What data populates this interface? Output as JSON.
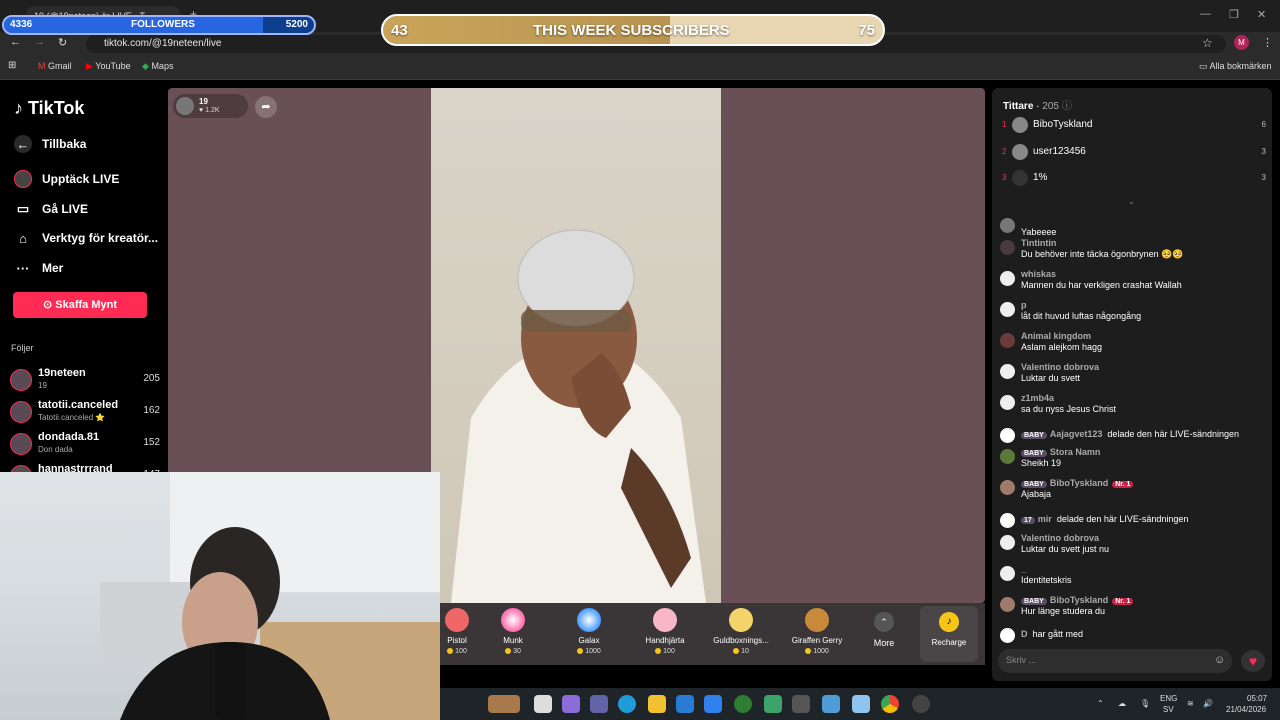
{
  "browser": {
    "tab_title": "19 (@19neteen) är LIVE - T",
    "url": "tiktok.com/@19neteen/live",
    "bookmarks": [
      "Gmail",
      "YouTube",
      "Maps"
    ],
    "all_bookmarks": "Alla bokmärken",
    "profile_initial": "M"
  },
  "overlay": {
    "followers_label": "FOLLOWERS",
    "followers_current": "4336",
    "followers_goal": "5200",
    "followers_progress": 0.834,
    "subs_label": "THIS WEEK SUBSCRIBERS",
    "subs_current": "43",
    "subs_goal": "75",
    "subs_progress": 0.573
  },
  "sidebar": {
    "logo": "TikTok",
    "back": "Tillbaka",
    "items": [
      "Upptäck LIVE",
      "Gå LIVE",
      "Verktyg för kreatör...",
      "Mer"
    ],
    "buy_coins": "Skaffa Mynt",
    "following_header": "Följer",
    "following": [
      {
        "name": "19neteen",
        "sub": "19",
        "count": "205"
      },
      {
        "name": "tatotii.canceled",
        "sub": "Tatotii.canceled ⭐",
        "count": "162"
      },
      {
        "name": "dondada.81",
        "sub": "Don dada",
        "count": "152"
      },
      {
        "name": "hannastrrrand",
        "sub": "",
        "count": "147"
      }
    ]
  },
  "live": {
    "host_name": "19",
    "host_likes": "1.2K"
  },
  "gifts": [
    {
      "name": "Pistol",
      "price": "100"
    },
    {
      "name": "Munk",
      "price": "30"
    },
    {
      "name": "Galax",
      "price": "1000"
    },
    {
      "name": "Handhjärta",
      "price": "100"
    },
    {
      "name": "Guldboxnings...",
      "price": "10"
    },
    {
      "name": "Giraffen Gerry",
      "price": "1000"
    }
  ],
  "gift_more": "More",
  "recharge": "Recharge",
  "viewers": {
    "header": "Tittare",
    "count": "205",
    "list": [
      {
        "rank": "1",
        "name": "BiboTyskland",
        "score": "6"
      },
      {
        "rank": "2",
        "name": "user123456",
        "score": "3"
      },
      {
        "rank": "3",
        "name": "1%",
        "score": "3"
      }
    ]
  },
  "chat": [
    {
      "name": "",
      "text": "Yabeeee"
    },
    {
      "name": "Tintintin",
      "text": "Du behöver inte täcka ögonbrynen 🥺🥺"
    },
    {
      "name": "whiskas",
      "text": "Mannen du har verkligen crashat Wallah"
    },
    {
      "name": "p",
      "text": "låt dit huvud luftas någongång"
    },
    {
      "name": "Animal kingdom",
      "text": "Aslam alejkom hagg"
    },
    {
      "name": "Valentino dobrova",
      "text": "Luktar du svett"
    },
    {
      "name": "z1mb4a",
      "text": "sa du nyss Jesus Christ"
    },
    {
      "name": "Aajagvet123",
      "badge": "BABY",
      "text": "delade den här LIVE-sändningen",
      "inline": true
    },
    {
      "name": "Stora Namn",
      "badge": "BABY",
      "text": "Sheikh 19"
    },
    {
      "name": "BiboTyskland",
      "badge": "BABY",
      "rank_badge": "Nr. 1",
      "text": "Ajabaja"
    },
    {
      "name": "mir",
      "badge": "17",
      "text": "delade den här LIVE-sändningen",
      "inline": true
    },
    {
      "name": "Valentino dobrova",
      "text": "Luktar du svett just nu"
    },
    {
      "name": "_",
      "text": "Identitetskris"
    },
    {
      "name": "BiboTyskland",
      "badge": "BABY",
      "rank_badge": "Nr. 1",
      "text": "Hur länge studera du"
    },
    {
      "name": "D",
      "text": "har gått med",
      "inline": true
    }
  ],
  "chat_placeholder": "Skriv ...",
  "taskbar": {
    "lang": "ENG",
    "lang2": "SV",
    "time": "05:07",
    "date": "21/04/2026"
  }
}
